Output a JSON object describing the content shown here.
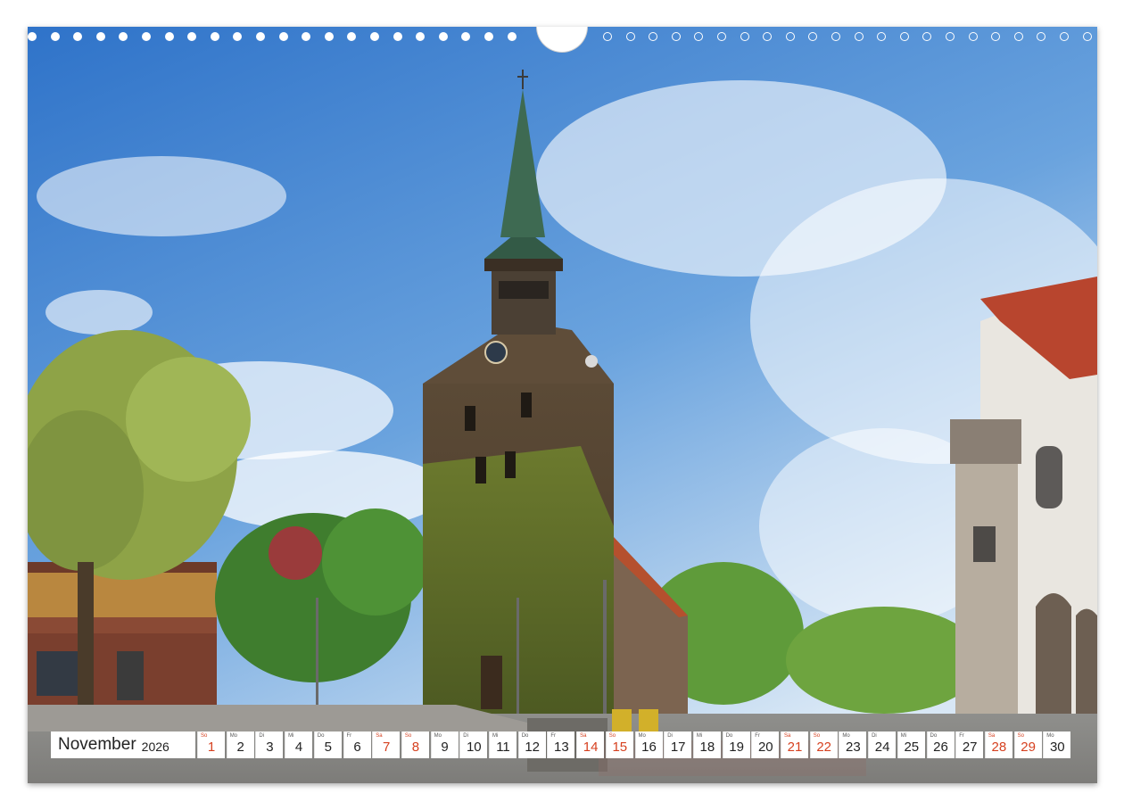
{
  "calendar": {
    "month": "November",
    "year": "2026",
    "days": [
      {
        "num": "1",
        "wd": "So",
        "kind": "sun"
      },
      {
        "num": "2",
        "wd": "Mo",
        "kind": "week"
      },
      {
        "num": "3",
        "wd": "Di",
        "kind": "week"
      },
      {
        "num": "4",
        "wd": "Mi",
        "kind": "week"
      },
      {
        "num": "5",
        "wd": "Do",
        "kind": "week"
      },
      {
        "num": "6",
        "wd": "Fr",
        "kind": "week"
      },
      {
        "num": "7",
        "wd": "Sa",
        "kind": "sat"
      },
      {
        "num": "8",
        "wd": "So",
        "kind": "sun"
      },
      {
        "num": "9",
        "wd": "Mo",
        "kind": "week"
      },
      {
        "num": "10",
        "wd": "Di",
        "kind": "week"
      },
      {
        "num": "11",
        "wd": "Mi",
        "kind": "week"
      },
      {
        "num": "12",
        "wd": "Do",
        "kind": "week"
      },
      {
        "num": "13",
        "wd": "Fr",
        "kind": "week"
      },
      {
        "num": "14",
        "wd": "Sa",
        "kind": "sat"
      },
      {
        "num": "15",
        "wd": "So",
        "kind": "sun"
      },
      {
        "num": "16",
        "wd": "Mo",
        "kind": "week"
      },
      {
        "num": "17",
        "wd": "Di",
        "kind": "week"
      },
      {
        "num": "18",
        "wd": "Mi",
        "kind": "week"
      },
      {
        "num": "19",
        "wd": "Do",
        "kind": "week"
      },
      {
        "num": "20",
        "wd": "Fr",
        "kind": "week"
      },
      {
        "num": "21",
        "wd": "Sa",
        "kind": "sat"
      },
      {
        "num": "22",
        "wd": "So",
        "kind": "sun"
      },
      {
        "num": "23",
        "wd": "Mo",
        "kind": "week"
      },
      {
        "num": "24",
        "wd": "Di",
        "kind": "week"
      },
      {
        "num": "25",
        "wd": "Mi",
        "kind": "week"
      },
      {
        "num": "26",
        "wd": "Do",
        "kind": "week"
      },
      {
        "num": "27",
        "wd": "Fr",
        "kind": "week"
      },
      {
        "num": "28",
        "wd": "Sa",
        "kind": "sat"
      },
      {
        "num": "29",
        "wd": "So",
        "kind": "sun"
      },
      {
        "num": "30",
        "wd": "Mo",
        "kind": "week"
      }
    ]
  },
  "colors": {
    "weekend": "#d6401f",
    "text": "#222222",
    "sky_top": "#3a7fd0",
    "sky_bottom": "#c9def2"
  }
}
